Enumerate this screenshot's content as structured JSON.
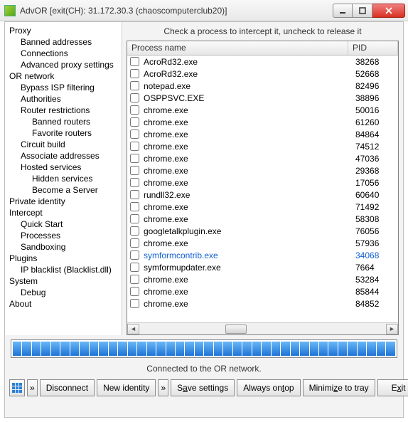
{
  "window": {
    "title": "AdvOR [exit(CH): 31.172.30.3 (chaoscomputerclub20)]"
  },
  "tree": [
    {
      "lvl": 0,
      "label": "Proxy"
    },
    {
      "lvl": 1,
      "label": "Banned addresses"
    },
    {
      "lvl": 1,
      "label": "Connections"
    },
    {
      "lvl": 1,
      "label": "Advanced proxy settings"
    },
    {
      "lvl": 0,
      "label": "OR network"
    },
    {
      "lvl": 1,
      "label": "Bypass ISP filtering"
    },
    {
      "lvl": 1,
      "label": "Authorities"
    },
    {
      "lvl": 1,
      "label": "Router restrictions"
    },
    {
      "lvl": 2,
      "label": "Banned routers"
    },
    {
      "lvl": 2,
      "label": "Favorite routers"
    },
    {
      "lvl": 1,
      "label": "Circuit build"
    },
    {
      "lvl": 1,
      "label": "Associate addresses"
    },
    {
      "lvl": 1,
      "label": "Hosted services"
    },
    {
      "lvl": 2,
      "label": "Hidden services"
    },
    {
      "lvl": 2,
      "label": "Become a Server"
    },
    {
      "lvl": 0,
      "label": "Private identity"
    },
    {
      "lvl": 0,
      "label": "Intercept"
    },
    {
      "lvl": 1,
      "label": "Quick Start"
    },
    {
      "lvl": 1,
      "label": "Processes"
    },
    {
      "lvl": 1,
      "label": "Sandboxing"
    },
    {
      "lvl": 0,
      "label": "Plugins"
    },
    {
      "lvl": 1,
      "label": "IP blacklist (Blacklist.dll)"
    },
    {
      "lvl": 0,
      "label": "System"
    },
    {
      "lvl": 1,
      "label": "Debug"
    },
    {
      "lvl": 0,
      "label": "About"
    }
  ],
  "hint": "Check a process to intercept it, uncheck to release it",
  "columns": {
    "name": "Process name",
    "pid": "PID"
  },
  "processes": [
    {
      "name": "AcroRd32.exe",
      "pid": "38268",
      "hl": false
    },
    {
      "name": "AcroRd32.exe",
      "pid": "52668",
      "hl": false
    },
    {
      "name": "notepad.exe",
      "pid": "82496",
      "hl": false
    },
    {
      "name": "OSPPSVC.EXE",
      "pid": "38896",
      "hl": false
    },
    {
      "name": "chrome.exe",
      "pid": "50016",
      "hl": false
    },
    {
      "name": "chrome.exe",
      "pid": "61260",
      "hl": false
    },
    {
      "name": "chrome.exe",
      "pid": "84864",
      "hl": false
    },
    {
      "name": "chrome.exe",
      "pid": "74512",
      "hl": false
    },
    {
      "name": "chrome.exe",
      "pid": "47036",
      "hl": false
    },
    {
      "name": "chrome.exe",
      "pid": "29368",
      "hl": false
    },
    {
      "name": "chrome.exe",
      "pid": "17056",
      "hl": false
    },
    {
      "name": "rundll32.exe",
      "pid": "60640",
      "hl": false
    },
    {
      "name": "chrome.exe",
      "pid": "71492",
      "hl": false
    },
    {
      "name": "chrome.exe",
      "pid": "58308",
      "hl": false
    },
    {
      "name": "googletalkplugin.exe",
      "pid": "76056",
      "hl": false
    },
    {
      "name": "chrome.exe",
      "pid": "57936",
      "hl": false
    },
    {
      "name": "symformcontrib.exe",
      "pid": "34068",
      "hl": true
    },
    {
      "name": "symformupdater.exe",
      "pid": "7664",
      "hl": false
    },
    {
      "name": "chrome.exe",
      "pid": "53284",
      "hl": false
    },
    {
      "name": "chrome.exe",
      "pid": "85844",
      "hl": false
    },
    {
      "name": "chrome.exe",
      "pid": "84852",
      "hl": false
    }
  ],
  "status": "Connected to the OR network.",
  "buttons": {
    "disconnect": "Disconnect",
    "newid_pre": "New identity",
    "newid_arrow": "»",
    "save_pre": "S",
    "save_ul": "a",
    "save_post": "ve settings",
    "aot_pre": "Always on ",
    "aot_ul": "t",
    "aot_post": "op",
    "min_pre": "Minimi",
    "min_ul": "z",
    "min_post": "e to tray",
    "exit_pre": "E",
    "exit_ul": "x",
    "exit_post": "it"
  }
}
